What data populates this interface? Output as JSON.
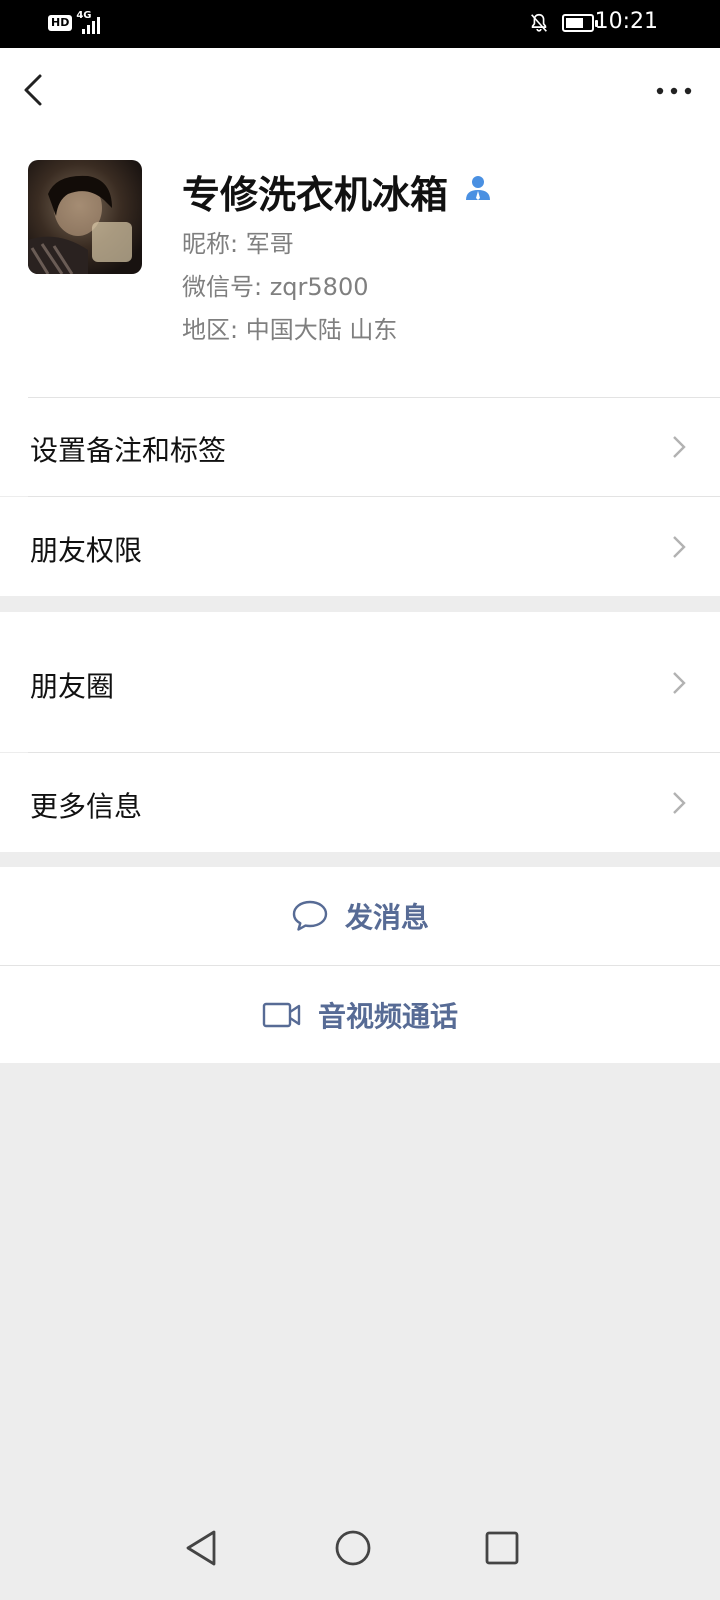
{
  "status_bar": {
    "hd": "HD",
    "network": "4G",
    "time": "10:21",
    "battery_level": 0.6
  },
  "profile": {
    "name": "专修洗衣机冰箱",
    "nickname": "昵称:  军哥",
    "wechat_id": "微信号:  zqr5800",
    "region": "地区:  中国大陆  山东"
  },
  "menu": {
    "remark_tags": "设置备注和标签",
    "friend_permissions": "朋友权限",
    "moments": "朋友圈",
    "more_info": "更多信息"
  },
  "actions": {
    "send_message": "发消息",
    "video_call": "音视频通话"
  },
  "colors": {
    "accent": "#576b95",
    "verified": "#4a90e2",
    "background": "#ededed"
  }
}
